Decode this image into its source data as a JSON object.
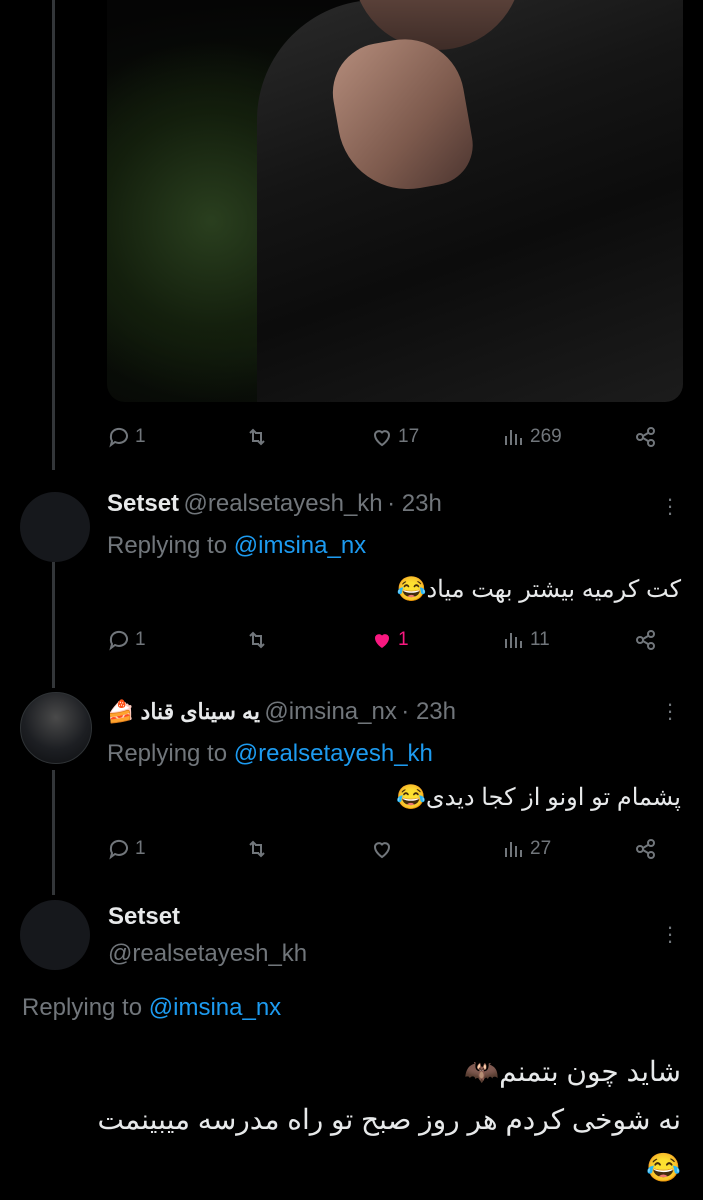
{
  "post": {
    "actions": {
      "replies": "1",
      "likes": "17",
      "views": "269"
    }
  },
  "reply1": {
    "name": "Setset",
    "handle": "@realsetayesh_kh",
    "time": "· 23h",
    "replying_prefix": "Replying to",
    "replying_to": "@imsina_nx",
    "text": "کت کرمیه بیشتر بهت میاد",
    "emoji": "😂",
    "actions": {
      "replies": "1",
      "likes": "1",
      "views": "11"
    },
    "like_color": "#f91880"
  },
  "reply2": {
    "name": "یه سینای قناد",
    "name_emoji": "🍰",
    "handle": "@imsina_nx",
    "time": "· 23h",
    "replying_prefix": "Replying to",
    "replying_to": "@realsetayesh_kh",
    "text": "پشمام تو اونو از کجا دیدی",
    "emoji": "😂",
    "actions": {
      "replies": "1",
      "likes": "",
      "views": "27"
    }
  },
  "main": {
    "name": "Setset",
    "handle": "@realsetayesh_kh",
    "replying_prefix": "Replying to",
    "replying_to": "@imsina_nx",
    "line1": "شاید چون بتمنم",
    "line1_emoji": "🦇",
    "line2": "نه شوخی کردم هر روز صبح تو راه مدرسه میبینمت",
    "line3_emoji": "😂"
  },
  "colors": {
    "accent": "#1d9bf0",
    "muted": "#71767b",
    "like": "#f91880"
  }
}
